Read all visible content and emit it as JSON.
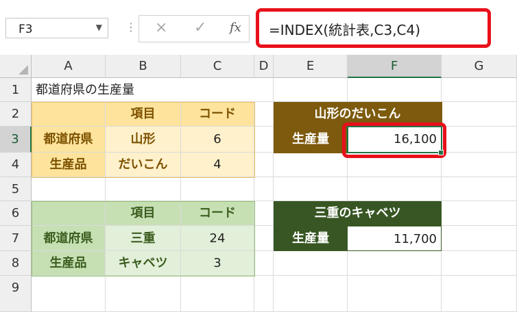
{
  "formula_bar": {
    "name_box": "F3",
    "cancel_icon": "×",
    "enter_icon": "✓",
    "fx_label": "fx",
    "formula": "=INDEX(統計表,C3,C4)"
  },
  "columns": [
    "A",
    "B",
    "C",
    "D",
    "E",
    "F",
    "G"
  ],
  "rows": [
    "1",
    "2",
    "3",
    "4",
    "5",
    "6",
    "7",
    "8",
    "9"
  ],
  "selected_cell": "F3",
  "cells": {
    "A1": "都道府県の生産量",
    "B2": "項目",
    "C2": "コード",
    "A3": "都道府県",
    "B3": "山形",
    "C3": "6",
    "A4": "生産品",
    "B4": "だいこん",
    "C4": "4",
    "B6": "項目",
    "C6": "コード",
    "A7": "都道府県",
    "B7": "三重",
    "C7": "24",
    "A8": "生産品",
    "B8": "キャベツ",
    "C8": "3",
    "E2": "山形のだいこん",
    "E3": "生産量",
    "F3": "16,100",
    "E6": "三重のキャベツ",
    "E7": "生産量",
    "F7": "11,700"
  },
  "colors": {
    "highlight_red": "#e8101a",
    "excel_green": "#217346",
    "yellow_header": "#fde39c",
    "yellow_body": "#fff1cc",
    "green_header": "#c6e0b4",
    "green_body": "#e2efd9",
    "brown_title": "#7d5a0d",
    "dark_green_title": "#375623"
  }
}
